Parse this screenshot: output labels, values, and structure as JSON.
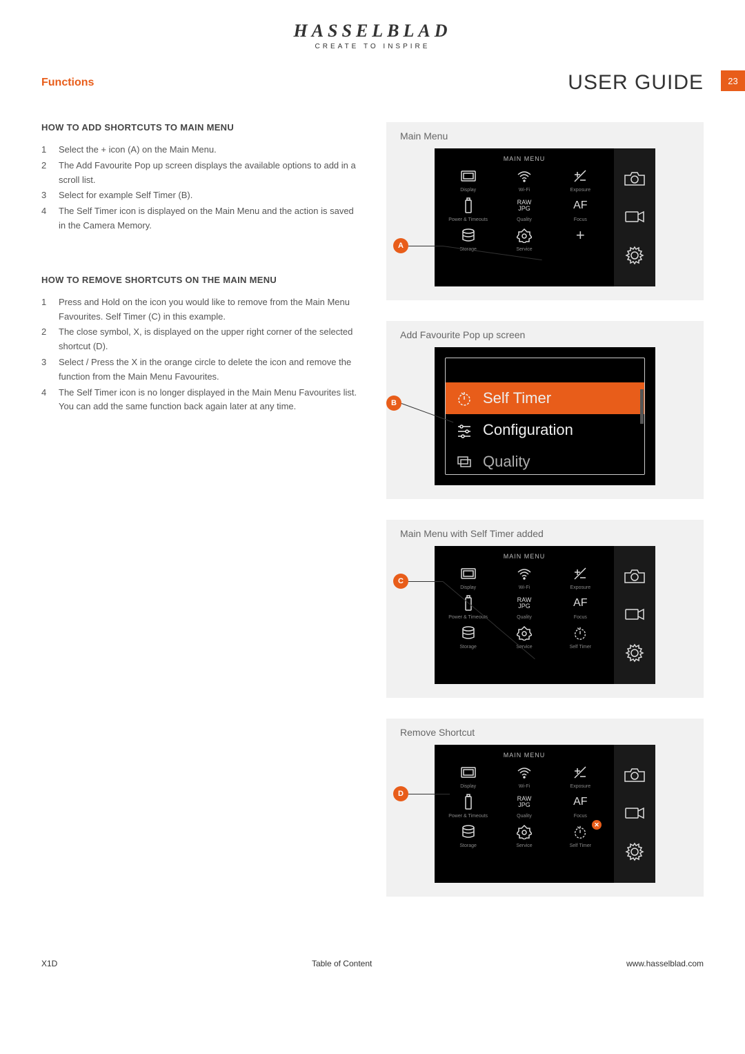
{
  "brand": {
    "name": "HASSELBLAD",
    "tagline": "CREATE TO INSPIRE"
  },
  "header": {
    "section": "Functions",
    "title": "USER GUIDE",
    "page": "23"
  },
  "section_add": {
    "heading": "HOW TO ADD SHORTCUTS TO MAIN MENU",
    "steps": [
      "Select the + icon (A) on the Main Menu.",
      "The Add Favourite Pop up screen displays the available options to add in a scroll list.",
      "Select for example Self Timer (B).",
      "The Self Timer icon is displayed on the Main Menu and the action is saved in the Camera Memory."
    ]
  },
  "section_remove": {
    "heading": "HOW TO REMOVE SHORTCUTS ON THE MAIN MENU",
    "steps": [
      "Press and Hold on the icon you would like to remove from the Main Menu Favourites. Self Timer (C) in this example.",
      "The close symbol, X, is displayed on the upper right corner of the selected shortcut (D).",
      "Select / Press the X in the orange circle to delete the icon and remove the function from the Main Menu Favourites.",
      "The Self Timer icon is no longer displayed in the Main Menu Favourites list. You can add the same function back again later at any time."
    ]
  },
  "panels": {
    "p1": {
      "title": "Main Menu",
      "callout": "A"
    },
    "p2": {
      "title": "Add Favourite Pop up screen",
      "callout": "B"
    },
    "p3": {
      "title": "Main Menu with Self Timer added",
      "callout": "C"
    },
    "p4": {
      "title": "Remove Shortcut",
      "callout": "D"
    }
  },
  "menu": {
    "title": "MAIN MENU",
    "items": {
      "display": "Display",
      "wifi": "Wi-Fi",
      "exposure": "Exposure",
      "power": "Power & Timeouts",
      "quality": "Quality",
      "focus": "Focus",
      "storage": "Storage",
      "service": "Service",
      "selftimer": "Self Timer"
    },
    "raw_jpg": "RAW\nJPG",
    "af": "AF",
    "plus": "+"
  },
  "popup": {
    "selftimer": "Self Timer",
    "configuration": "Configuration",
    "quality": "Quality"
  },
  "footer": {
    "model": "X1D",
    "toc": "Table of Content",
    "url": "www.hasselblad.com"
  }
}
